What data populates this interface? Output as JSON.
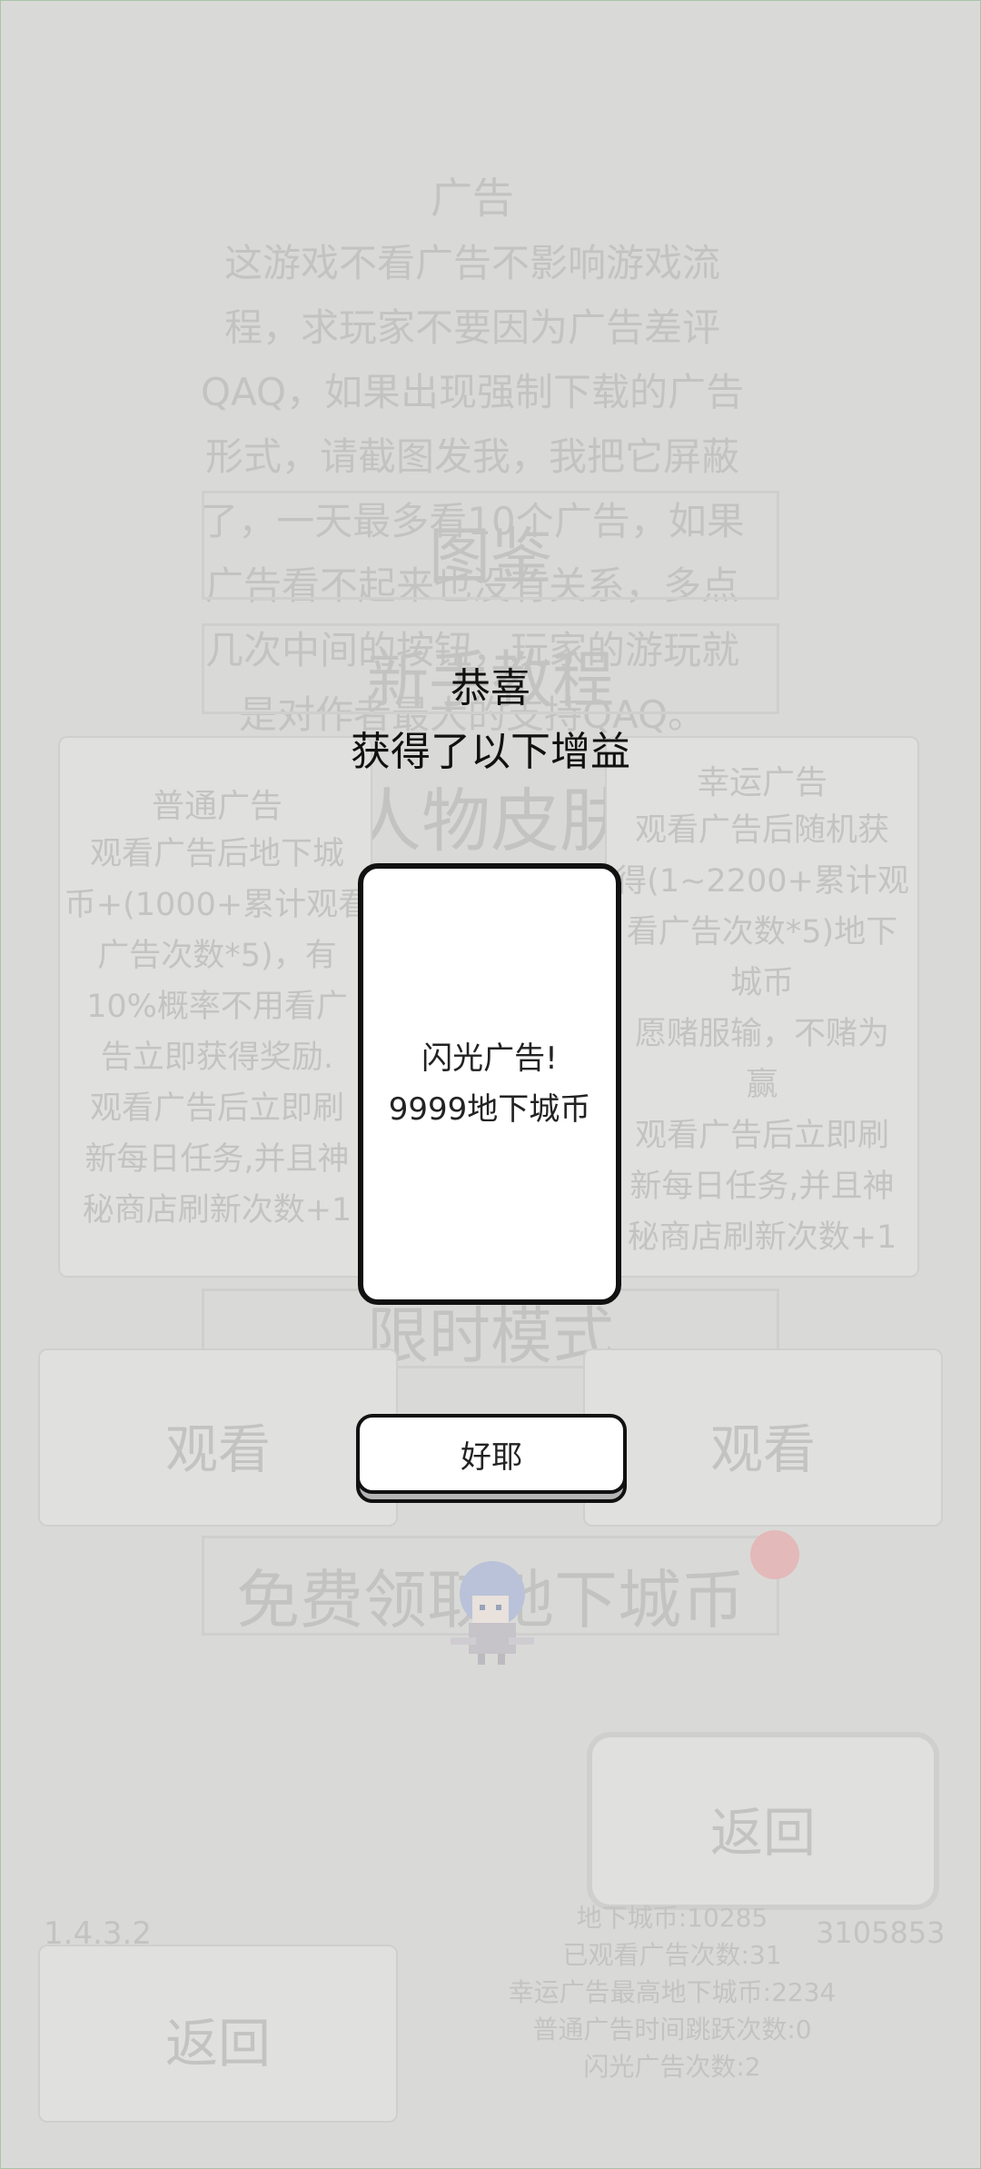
{
  "background": {
    "ad_notice": {
      "title": "广告",
      "body": "这游戏不看广告不影响游戏流\n程，求玩家不要因为广告差评\nQAQ，如果出现强制下载的广告\n形式，请截图发我，我把它屏蔽\n了，一天最多看10个广告，如果\n广告看不起来也没有关系，多点\n几次中间的按钮，玩家的游玩就\n是对作者最大的支持QAQ。"
    },
    "menu_items": [
      "图鉴",
      "新手教程",
      "人物皮肤",
      "限时模式",
      "免费领取地下城币"
    ],
    "normal_ad": {
      "title": "普通广告",
      "description": "观看广告后地下城\n币+(1000+累计观看\n广告次数*5)，有\n10%概率不用看广\n告立即获得奖励.\n观看广告后立即刷\n新每日任务,并且神\n秘商店刷新次数+1",
      "watch_label": "观看"
    },
    "lucky_ad": {
      "title": "幸运广告",
      "description": "观看广告后随机获\n得(1~2200+累计观\n看广告次数*5)地下\n城币\n愿赌服输，不赌为\n赢\n观看广告后立即刷\n新每日任务,并且神\n秘商店刷新次数+1",
      "watch_label": "观看"
    },
    "return_label_right": "返回",
    "return_label_left": "返回",
    "version": "1.4.3.2",
    "id_number": "3105853",
    "stats": [
      "地下城币:10285",
      "已观看广告次数:31",
      "幸运广告最高地下城币:2234",
      "普通广告时间跳跃次数:0",
      "闪光广告次数:2"
    ]
  },
  "dialog": {
    "title_line1": "恭喜",
    "title_line2": "获得了以下增益",
    "reward_text": "闪光广告!\n9999地下城币",
    "confirm_label": "好耶"
  },
  "colors": {
    "background": "#d9dad7",
    "faded_text": "#c3c4c1",
    "dialog_border": "#111111",
    "badge": "#e3b9b9"
  }
}
